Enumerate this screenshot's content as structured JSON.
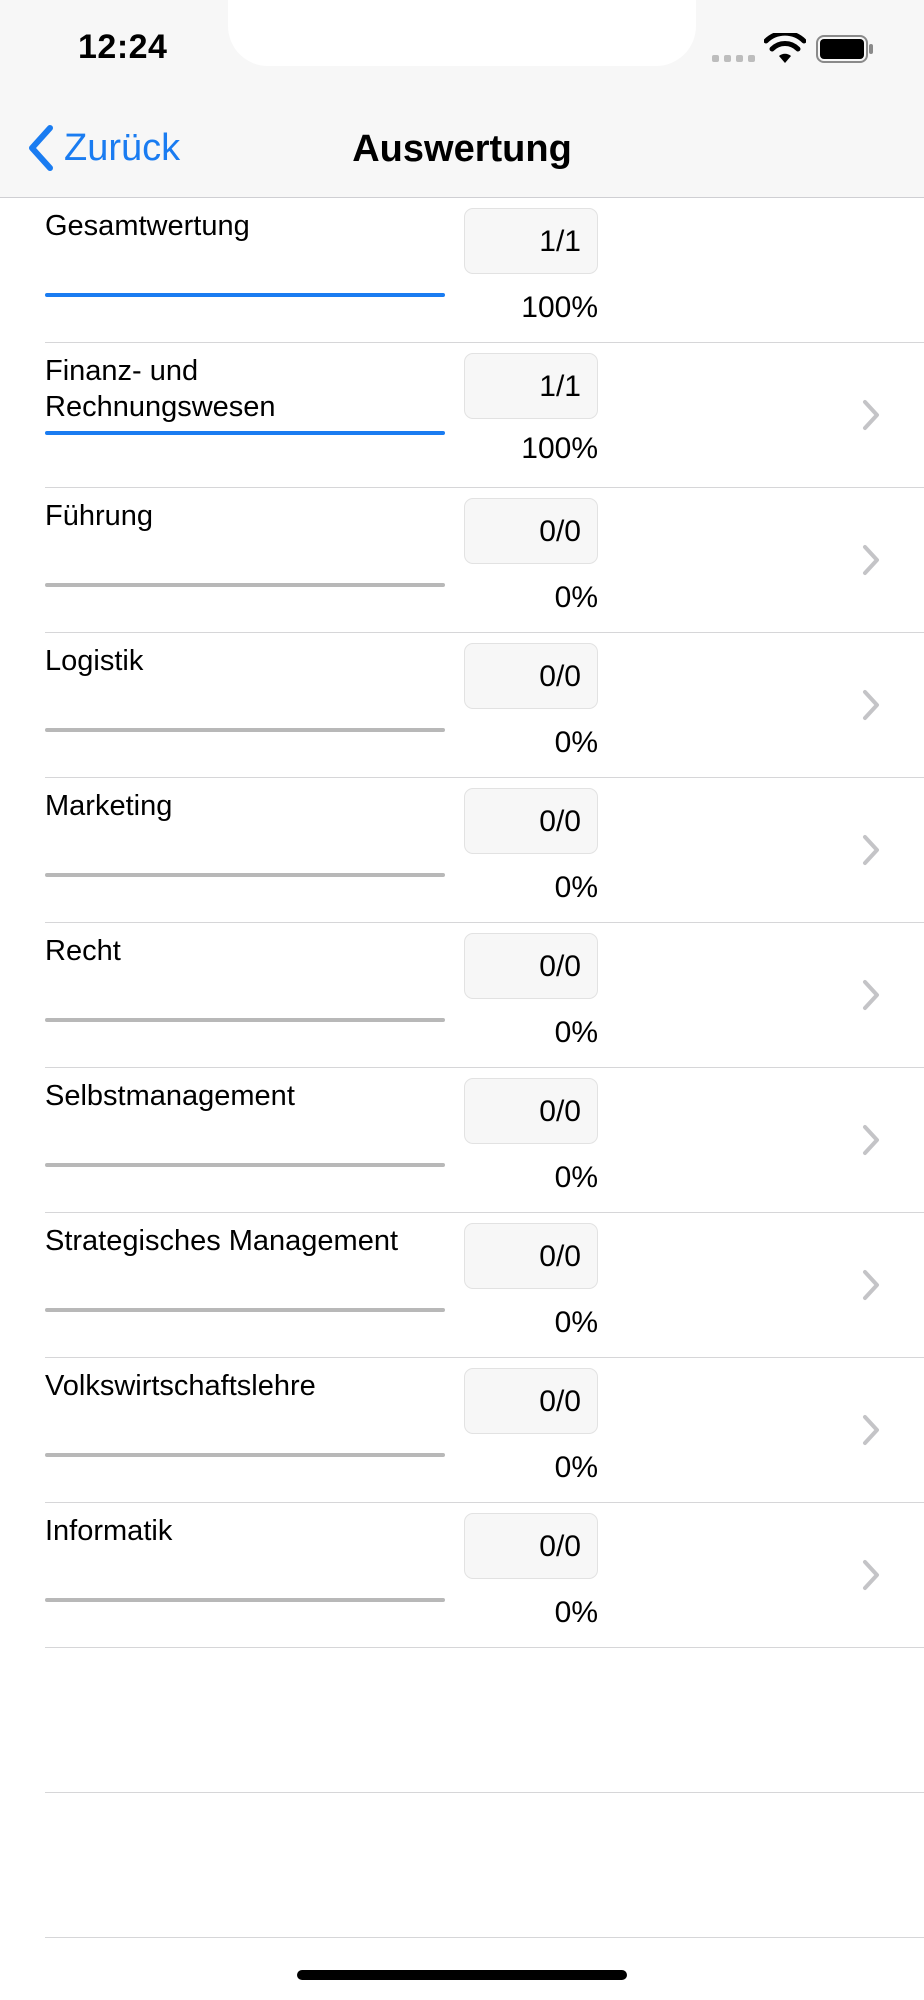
{
  "status_bar": {
    "time": "12:24",
    "signal_icon": "signal-dots-icon",
    "wifi_icon": "wifi-icon",
    "battery_icon": "battery-icon"
  },
  "nav": {
    "back_label": "Zurück",
    "back_icon": "chevron-left-icon",
    "title": "Auswertung"
  },
  "colors": {
    "accent": "#1a7cf1",
    "bar_empty": "#b8b8b8",
    "chevron": "#c4c4c7"
  },
  "rows": [
    {
      "label": "Gesamtwertung",
      "score": "1/1",
      "percent": "100%",
      "progress": 1.0,
      "has_chevron": false
    },
    {
      "label": "Finanz- und\nRechnungswesen",
      "score": "1/1",
      "percent": "100%",
      "progress": 1.0,
      "has_chevron": true
    },
    {
      "label": "Führung",
      "score": "0/0",
      "percent": "0%",
      "progress": 0,
      "has_chevron": true
    },
    {
      "label": "Logistik",
      "score": "0/0",
      "percent": "0%",
      "progress": 0,
      "has_chevron": true
    },
    {
      "label": "Marketing",
      "score": "0/0",
      "percent": "0%",
      "progress": 0,
      "has_chevron": true
    },
    {
      "label": "Recht",
      "score": "0/0",
      "percent": "0%",
      "progress": 0,
      "has_chevron": true
    },
    {
      "label": "Selbstmanagement",
      "score": "0/0",
      "percent": "0%",
      "progress": 0,
      "has_chevron": true
    },
    {
      "label": "Strategisches Management",
      "score": "0/0",
      "percent": "0%",
      "progress": 0,
      "has_chevron": true
    },
    {
      "label": "Volkswirtschaftslehre",
      "score": "0/0",
      "percent": "0%",
      "progress": 0,
      "has_chevron": true
    },
    {
      "label": "Informatik",
      "score": "0/0",
      "percent": "0%",
      "progress": 0,
      "has_chevron": true
    }
  ]
}
